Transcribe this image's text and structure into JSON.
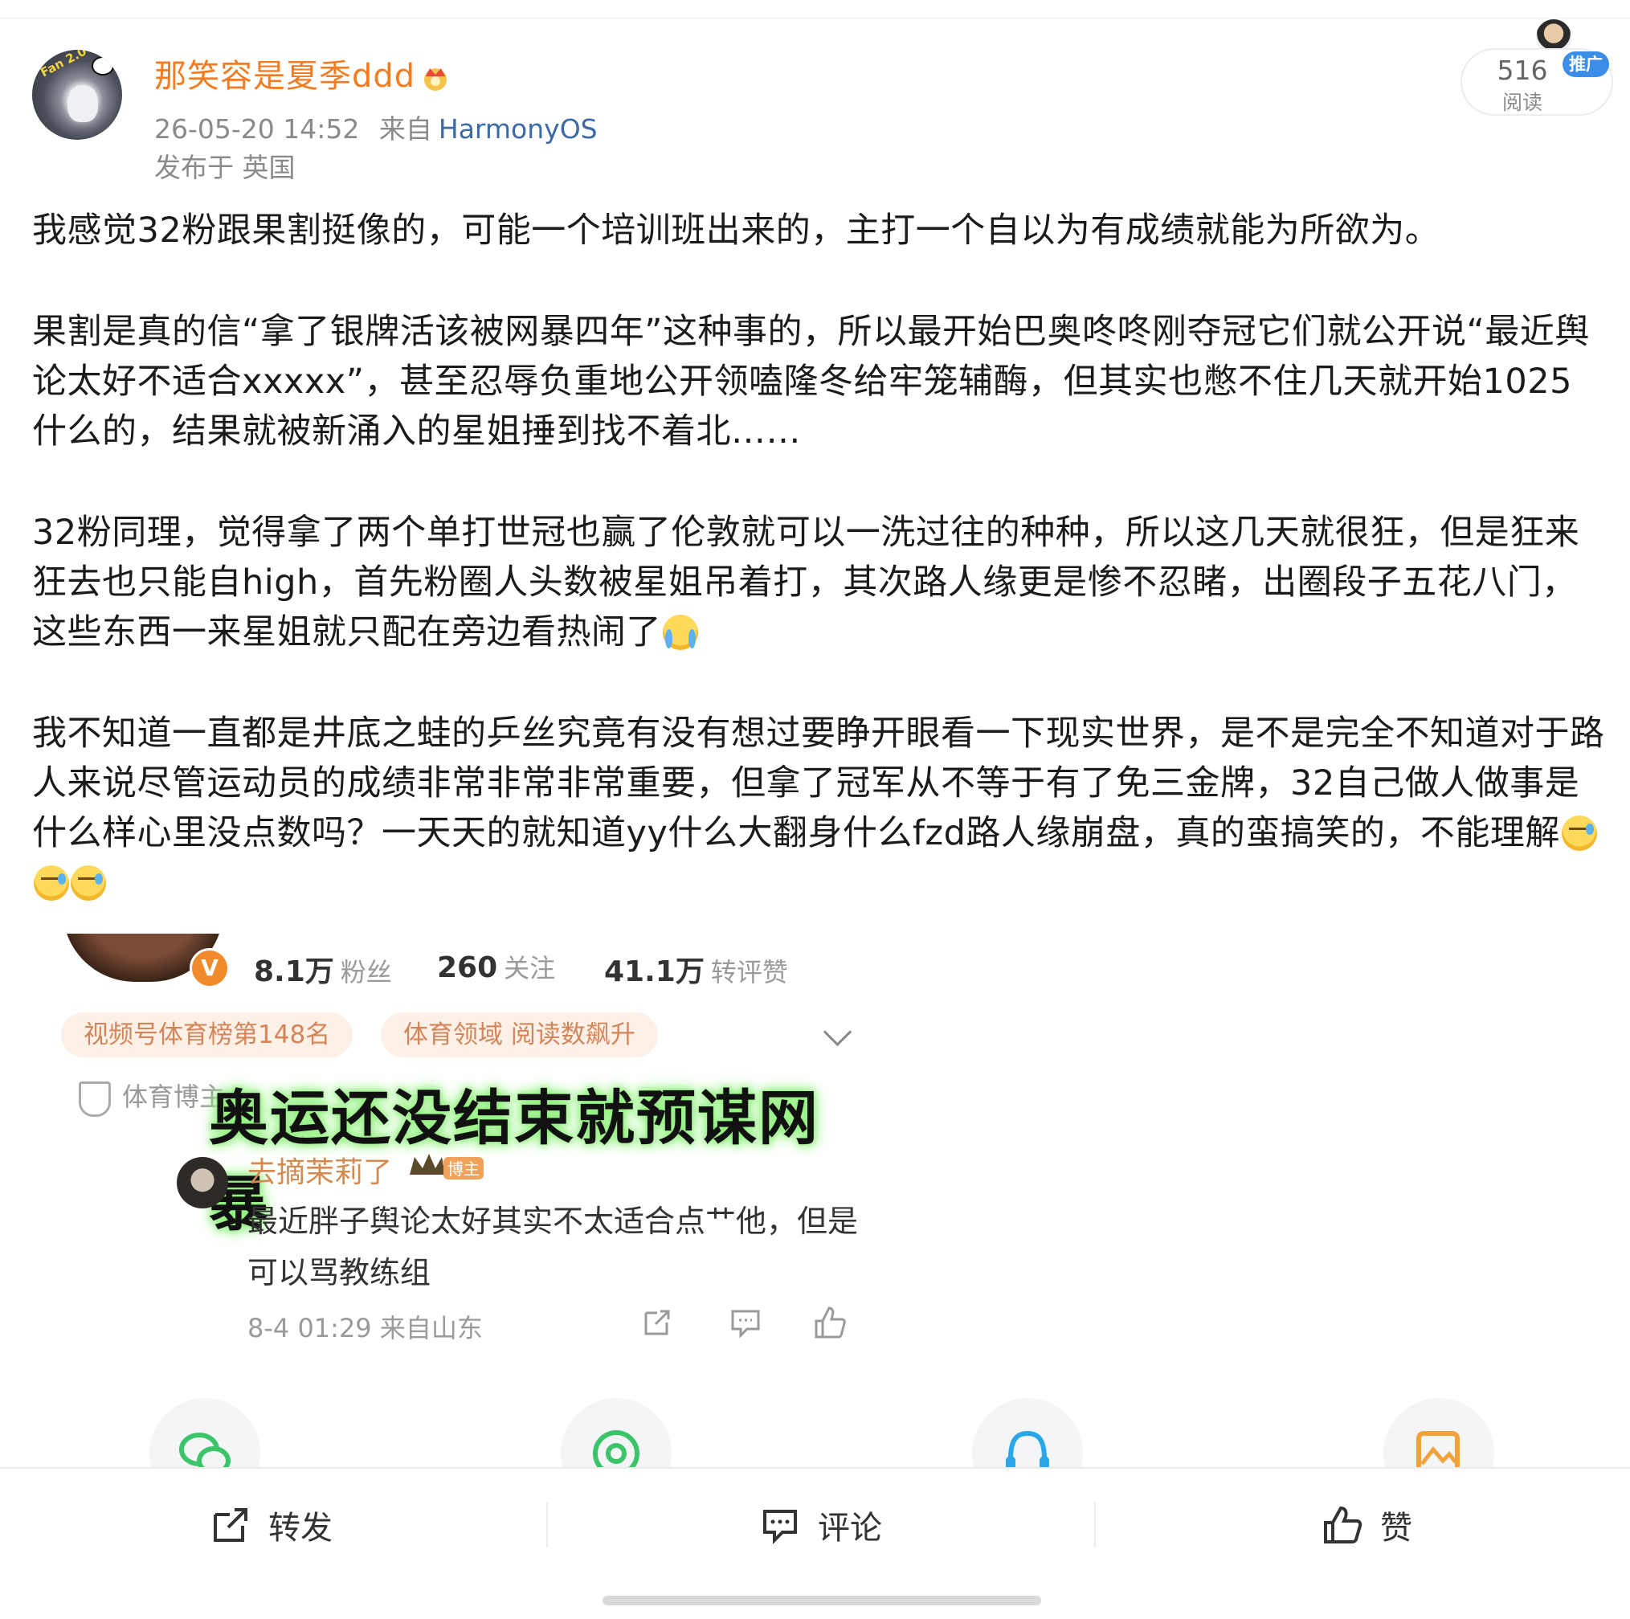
{
  "header": {
    "username": "那笑容是夏季ddd",
    "timestamp": "26-05-20 14:52",
    "source_prefix": "来自",
    "source": "HarmonyOS",
    "location": "发布于 英国",
    "read_count": "516",
    "read_label": "阅读",
    "promo_badge": "推广",
    "avatar_tag": "Fan 2.0"
  },
  "post": {
    "paragraphs": [
      "我感觉32粉跟果割挺像的，可能一个培训班出来的，主打一个自以为有成绩就能为所欲为。",
      "果割是真的信“拿了银牌活该被网暴四年”这种事的，所以最开始巴奥咚咚刚夺冠它们就公开说“最近舆论太好不适合xxxxx”，甚至忍辱负重地公开领嗑隆冬给牢笼辅酶，但其实也憋不住几天就开始1025什么的，结果就被新涌入的星姐捶到找不着北……",
      "32粉同理，觉得拿了两个单打世冠也赢了伦敦就可以一洗过往的种种，所以这几天就很狂，但是狂来狂去也只能自high，首先粉圈人头数被星姐吊着打，其次路人缘更是惨不忍睹，出圈段子五花八门，这些东西一来星姐就只配在旁边看热闹了",
      "我不知道一直都是井底之蛙的乒丝究竟有没有想过要睁开眼看一下现实世界，是不是完全不知道对于路人来说尽管运动员的成绩非常非常非常重要，但拿了冠军从不等于有了免三金牌，32自己做人做事是什么样心里没点数吗？一天天的就知道yy什么大翻身什么fzd路人缘崩盘，真的蛮搞笑的，不能理解"
    ]
  },
  "embed": {
    "fans_count": "8.1万",
    "fans_label": "粉丝",
    "follow_count": "260",
    "follow_label": "关注",
    "likes_count": "41.1万",
    "likes_label": "转评赞",
    "chip1": "视频号体育榜第148名",
    "chip2": "体育领域 阅读数飙升",
    "cert_text": "体育博主",
    "headline": "奥运还没结束就预谋网暴",
    "commenter": "去摘茉莉了",
    "commenter_badge": "博主",
    "comment": "最近胖子舆论太好其实不太适合点艹他，但是可以骂教练组",
    "comment_time": "8-4 01:29 来自山东"
  },
  "actions": {
    "repost": "转发",
    "comment": "评论",
    "like": "赞"
  },
  "icons": {
    "share": [
      "wechat-icon",
      "moments-icon",
      "qq-icon",
      "image-icon"
    ]
  },
  "colors": {
    "username": "#f47b20",
    "source": "#3b6aa5",
    "promo": "#3a8ee8",
    "headline_glow": "#8ef07a"
  }
}
